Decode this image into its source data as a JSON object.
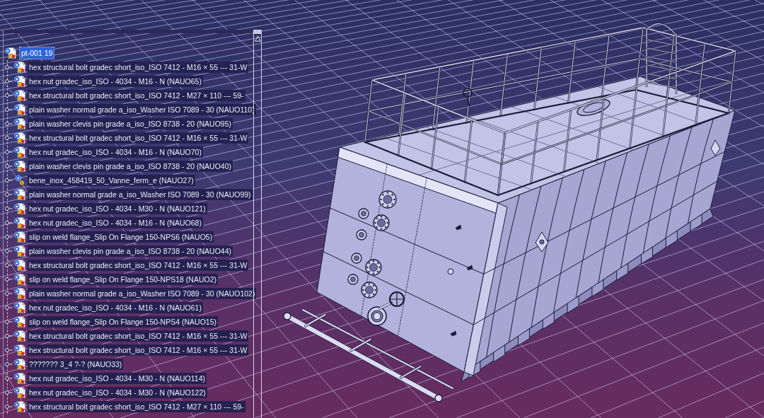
{
  "tree": {
    "label": "pt-001 19",
    "kind": "part",
    "selected": true,
    "children": [
      {
        "label": "hex structural bolt gradec short_iso_ISO 7412 - M16 × 55 --- 31-W",
        "kind": "part",
        "selected": false
      },
      {
        "label": "hex nut gradec_iso_ISO - 4034 - M16 - N (NAUO65)",
        "kind": "part",
        "selected": false
      },
      {
        "label": "hex structural bolt gradec short_iso_ISO 7412 - M27 × 110 --- 59-",
        "kind": "part",
        "selected": false
      },
      {
        "label": "plain washer normal grade a_iso_Washer ISO 7089 - 30 (NAUO110)",
        "kind": "part",
        "selected": false
      },
      {
        "label": "plain washer clevis pin grade a_iso_ISO 8738 - 20 (NAUO95)",
        "kind": "part",
        "selected": false
      },
      {
        "label": "hex structural bolt gradec short_iso_ISO 7412 - M16 × 55 --- 31-W",
        "kind": "part",
        "selected": false
      },
      {
        "label": "hex nut gradec_iso_ISO - 4034 - M16 - N (NAUO70)",
        "kind": "part",
        "selected": false
      },
      {
        "label": "plain washer clevis pin grade a_iso_ISO 8738 - 20 (NAUO40)",
        "kind": "part",
        "selected": false
      },
      {
        "label": "bene_inox_458419_50_Vanne_ferm_e (NAUO27)",
        "kind": "component",
        "selected": false
      },
      {
        "label": "plain washer normal grade a_iso_Washer ISO 7089 - 30 (NAUO99)",
        "kind": "part",
        "selected": false
      },
      {
        "label": "hex nut gradec_iso_ISO - 4034 - M30 - N (NAUO121)",
        "kind": "part",
        "selected": false
      },
      {
        "label": "hex nut gradec_iso_ISO - 4034 - M16 - N (NAUO68)",
        "kind": "part",
        "selected": false
      },
      {
        "label": "slip on weld flange_Slip On Flange 150-NPS6 (NAUO5)",
        "kind": "part",
        "selected": false
      },
      {
        "label": "plain washer clevis pin grade a_iso_ISO 8738 - 20 (NAUO44)",
        "kind": "part",
        "selected": false
      },
      {
        "label": "hex structural bolt gradec short_iso_ISO 7412 - M16 × 55 --- 31-W",
        "kind": "part",
        "selected": false
      },
      {
        "label": "slip on weld flange_Slip On Flange 150-NPS18 (NAUO2)",
        "kind": "part",
        "selected": false
      },
      {
        "label": "plain washer normal grade a_iso_Washer ISO 7089 - 30 (NAUO102)",
        "kind": "part",
        "selected": false
      },
      {
        "label": "hex nut gradec_iso_ISO - 4034 - M16 - N (NAUO61)",
        "kind": "part",
        "selected": false
      },
      {
        "label": "slip on weld flange_Slip On Flange 150-NPS4 (NAUO15)",
        "kind": "part",
        "selected": false
      },
      {
        "label": "hex structural bolt gradec short_iso_ISO 7412 - M16 × 55 --- 31-W",
        "kind": "part",
        "selected": false
      },
      {
        "label": "hex structural bolt gradec short_iso_ISO 7412 - M16 × 55 --- 31-W",
        "kind": "part",
        "selected": false
      },
      {
        "label": "??????? 3_4 ?-? (NAUO33)",
        "kind": "part",
        "selected": false
      },
      {
        "label": "hex nut gradec_iso_ISO - 4034 - M30 - N (NAUO114)",
        "kind": "part",
        "selected": false
      },
      {
        "label": "hex nut gradec_iso_ISO - 4034 - M30 - N (NAUO122)",
        "kind": "part",
        "selected": false
      },
      {
        "label": "hex structural bolt gradec short_iso_ISO 7412 - M27 × 110 --- 59-",
        "kind": "part",
        "selected": false
      }
    ]
  }
}
